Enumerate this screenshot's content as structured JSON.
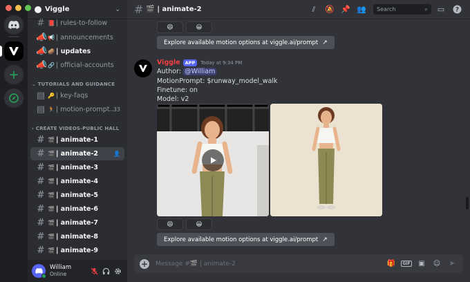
{
  "server": {
    "name": "Viggle"
  },
  "channels": {
    "top": [
      {
        "name": "rules-to-follow",
        "emoji": "📕",
        "unread": false
      },
      {
        "name": "announcements",
        "emoji": "📢",
        "unread": false
      },
      {
        "name": "updates",
        "emoji": "🥔",
        "unread": true
      },
      {
        "name": "official-accounts",
        "emoji": "🔗",
        "unread": false
      }
    ],
    "category_1": "TUTORIALS AND GUIDANCE",
    "tutorials": [
      {
        "name": "key-faqs",
        "emoji": "🔑",
        "badge": ""
      },
      {
        "name": "motion-prompt...",
        "emoji": "🏃",
        "badge": "33"
      }
    ],
    "category_2": "CREATE VIDEOS-PUBLIC HALL",
    "create": [
      {
        "name": "animate-1",
        "emoji": "🎬"
      },
      {
        "name": "animate-2",
        "emoji": "🎬"
      },
      {
        "name": "animate-3",
        "emoji": "🎬"
      },
      {
        "name": "animate-4",
        "emoji": "🎬"
      },
      {
        "name": "animate-5",
        "emoji": "🎬"
      },
      {
        "name": "animate-6",
        "emoji": "🎬"
      },
      {
        "name": "animate-7",
        "emoji": "🎬"
      },
      {
        "name": "animate-8",
        "emoji": "🎬"
      },
      {
        "name": "animate-9",
        "emoji": "🎬"
      }
    ],
    "separator": "|"
  },
  "user": {
    "name": "William",
    "status": "Online"
  },
  "topbar": {
    "channel_title": "🎬 | animate-2",
    "search_placeholder": "Search"
  },
  "message": {
    "author": "Viggle",
    "tag": "APP",
    "time": "Today at 9:34 PM",
    "author_label": "Author:",
    "mention": "@William",
    "motion_prompt": "MotionPrompt: $runway_model_walk",
    "finetune": "Finetune: on",
    "model": "Model: v2"
  },
  "reactions": [
    "😄",
    "😀"
  ],
  "explore_button_label": "Explore available motion options at viggle.ai/prompt",
  "composer": {
    "placeholder": "Message #🎬 | animate-2"
  },
  "colors": {
    "accent": "#5865f2",
    "author": "#f23f43",
    "online": "#23a559"
  }
}
